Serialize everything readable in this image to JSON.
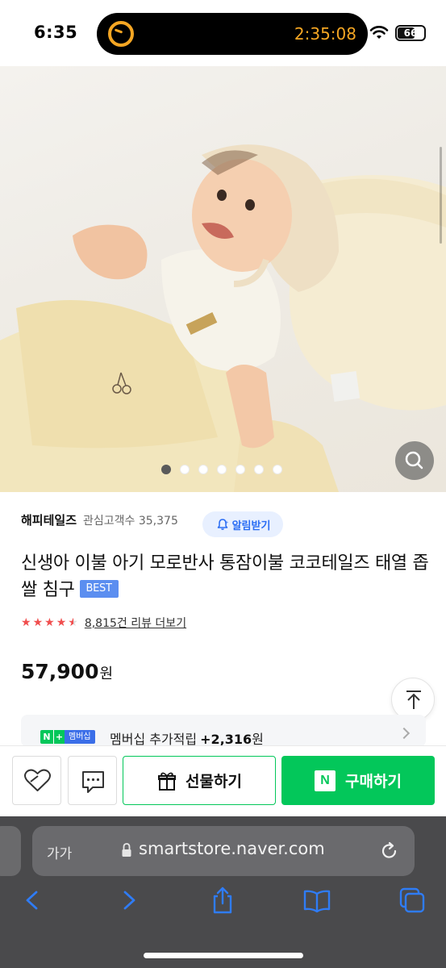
{
  "status_bar": {
    "time": "6:35",
    "timer": "2:35:08",
    "battery": "66",
    "battery_level": 0.66
  },
  "gallery": {
    "image_count": 7,
    "active_index": 0,
    "zoom_icon": "search-icon"
  },
  "store": {
    "name": "해피테일즈",
    "interest": "관심고객수 35,375",
    "alarm_label": "알림받기"
  },
  "product": {
    "title": "신생아 이불 아기 모로반사 통잠이불 코코테일즈 태열 좁쌀 침구",
    "badge": "BEST",
    "rating": 4.5,
    "review_link": "8,815건 리뷰 더보기",
    "price": "57,900",
    "price_unit": "원"
  },
  "membership": {
    "badge_n": "N",
    "badge_plus": "+",
    "badge_tag": "멤버십",
    "text": "멤버십 추가적립",
    "amount": "+2,316",
    "unit": "원"
  },
  "actions": {
    "gift_label": "선물하기",
    "buy_badge": "N",
    "buy_label": "구매하기"
  },
  "browser": {
    "aa": "가가",
    "url": "smartstore.naver.com"
  },
  "colors": {
    "naver_green": "#03c75a",
    "rating_red": "#f04e4e",
    "alarm_blue": "#2a6df4",
    "badge_blue": "#5b8ef0"
  }
}
